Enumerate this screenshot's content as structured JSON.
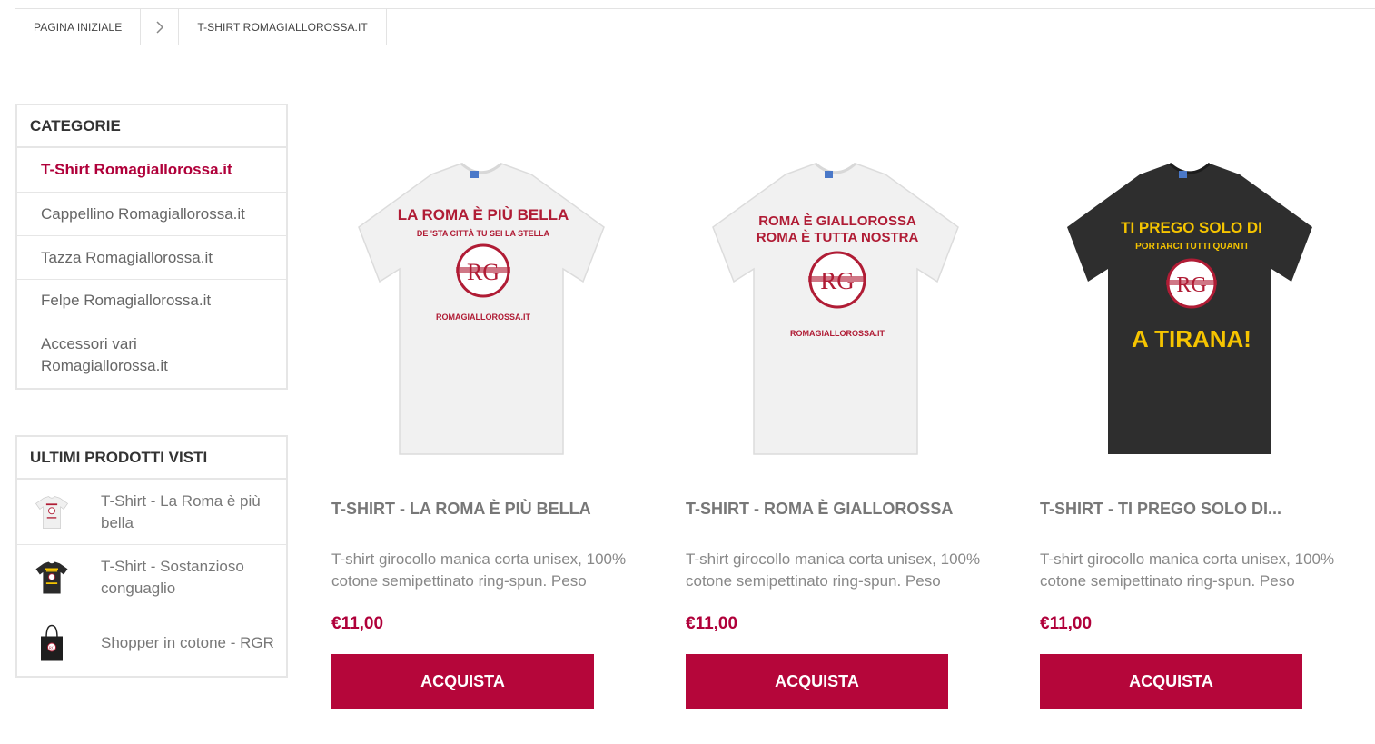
{
  "breadcrumb": {
    "home": "PAGINA INIZIALE",
    "current": "T-SHIRT ROMAGIALLOROSSA.IT"
  },
  "categories": {
    "title": "CATEGORIE",
    "items": [
      {
        "label": "T-Shirt Romagiallorossa.it"
      },
      {
        "label": "Cappellino Romagiallorossa.it"
      },
      {
        "label": "Tazza Romagiallorossa.it"
      },
      {
        "label": "Felpe Romagiallorossa.it"
      },
      {
        "label": "Accessori vari Romagiallorossa.it"
      }
    ]
  },
  "recent": {
    "title": "ULTIMI PRODOTTI VISTI",
    "items": [
      {
        "name": "T-Shirt - La Roma è più bella",
        "thumb": "white-tshirt"
      },
      {
        "name": "T-Shirt - Sostanzioso conguaglio",
        "thumb": "black-tshirt"
      },
      {
        "name": "Shopper in cotone - RGR",
        "thumb": "black-shopper-bag"
      }
    ]
  },
  "products": [
    {
      "title": "T-SHIRT - LA ROMA È PIÙ BELLA",
      "description": "T-shirt girocollo manica corta unisex, 100% cotone semipettinato ring-spun. Peso",
      "price": "€11,00",
      "button": "ACQUISTA",
      "shirt_color": "#f2f2f2",
      "print": {
        "line1": "LA ROMA È PIÙ BELLA",
        "line2": "DE 'STA CITTÀ TU SEI LA STELLA",
        "logo": "RG",
        "footer": "ROMAGIALLOROSSA.IT"
      }
    },
    {
      "title": "T-SHIRT - ROMA È GIALLOROSSA",
      "description": "T-shirt girocollo manica corta unisex, 100% cotone semipettinato ring-spun. Peso",
      "price": "€11,00",
      "button": "ACQUISTA",
      "shirt_color": "#f2f2f2",
      "print": {
        "line1": "ROMA È GIALLOROSSA",
        "line2": "ROMA È TUTTA NOSTRA",
        "logo": "RG",
        "footer": "ROMAGIALLOROSSA.IT"
      }
    },
    {
      "title": "T-SHIRT - TI PREGO SOLO DI...",
      "description": "T-shirt girocollo manica corta unisex, 100% cotone semipettinato ring-spun. Peso",
      "price": "€11,00",
      "button": "ACQUISTA",
      "shirt_color": "#2e2e2e",
      "print": {
        "line1": "TI PREGO SOLO DI",
        "line2": "PORTARCI TUTTI QUANTI",
        "logo": "RG",
        "footer": "A TIRANA!"
      }
    }
  ],
  "colors": {
    "accent": "#b5063a",
    "print_red": "#b01c35",
    "print_yellow": "#f5c400"
  }
}
